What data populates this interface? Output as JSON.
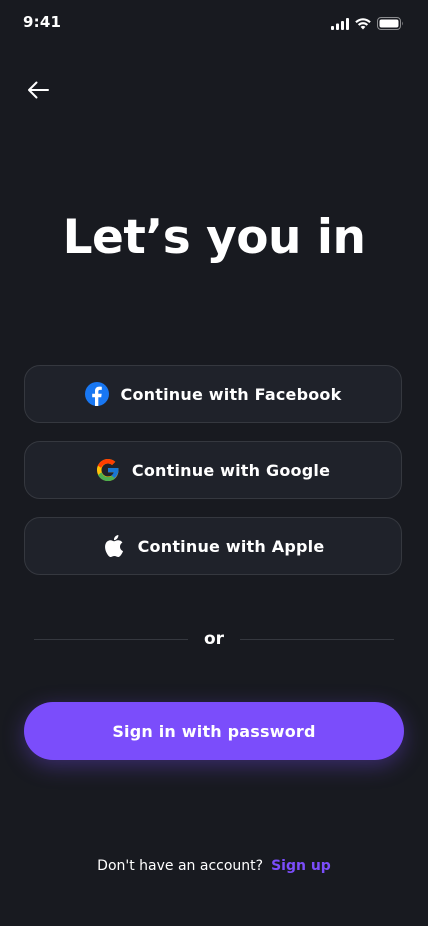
{
  "status_bar": {
    "time": "9:41"
  },
  "header": {
    "back_icon": "arrow-left-icon"
  },
  "title": "Let’s you in",
  "social_buttons": [
    {
      "label": "Continue with Facebook",
      "icon": "facebook-icon"
    },
    {
      "label": "Continue with Google",
      "icon": "google-icon"
    },
    {
      "label": "Continue with Apple",
      "icon": "apple-icon"
    }
  ],
  "divider_text": "or",
  "primary_button": {
    "label": "Sign in with password"
  },
  "footer": {
    "prompt": "Don't have an account?",
    "link": "Sign up"
  },
  "colors": {
    "background": "#181a20",
    "accent": "#7b4dfb",
    "card": "#1f222a",
    "border": "#35383f"
  }
}
